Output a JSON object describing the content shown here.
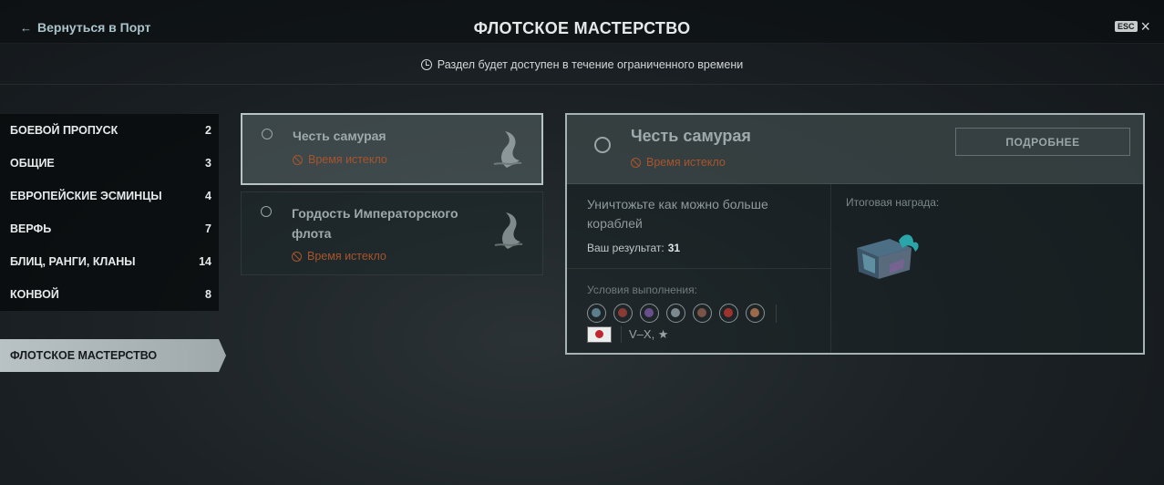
{
  "header": {
    "back_label": "Вернуться в Порт",
    "title": "ФЛОТСКОЕ МАСТЕРСТВО",
    "esc_key": "ESC",
    "close_symbol": "×"
  },
  "notice": "Раздел будет доступен в течение ограниченного времени",
  "sidebar": {
    "items": [
      {
        "label": "БОЕВОЙ ПРОПУСК",
        "count": "2"
      },
      {
        "label": "ОБЩИЕ",
        "count": "3"
      },
      {
        "label": "ЕВРОПЕЙСКИЕ ЭСМИНЦЫ",
        "count": "4"
      },
      {
        "label": "ВЕРФЬ",
        "count": "7"
      },
      {
        "label": "БЛИЦ, РАНГИ, КЛАНЫ",
        "count": "14"
      },
      {
        "label": "КОНВОЙ",
        "count": "8"
      }
    ],
    "active": "ФЛОТСКОЕ МАСТЕРСТВО"
  },
  "cards": [
    {
      "name": "Честь самурая",
      "status": "Время истекло",
      "icon": "whale-tail-icon"
    },
    {
      "name": "Гордость Императорского флота",
      "status": "Время истекло",
      "icon": "whale-tail-icon"
    }
  ],
  "detail": {
    "name": "Честь самурая",
    "status": "Время истекло",
    "more_button": "ПОДРОБНЕЕ",
    "task": "Уничтожьте как можно больше кораблей",
    "result_label": "Ваш результат:",
    "result_value": "31",
    "conditions_label": "Условия выполнения:",
    "nation": "japan-flag",
    "tiers": "V–X, ★",
    "reward_label": "Итоговая награда:",
    "reward_icon": "container-crate-icon"
  },
  "colors": {
    "expired": "#a7552c",
    "active_tab": "#b9c2c4"
  }
}
